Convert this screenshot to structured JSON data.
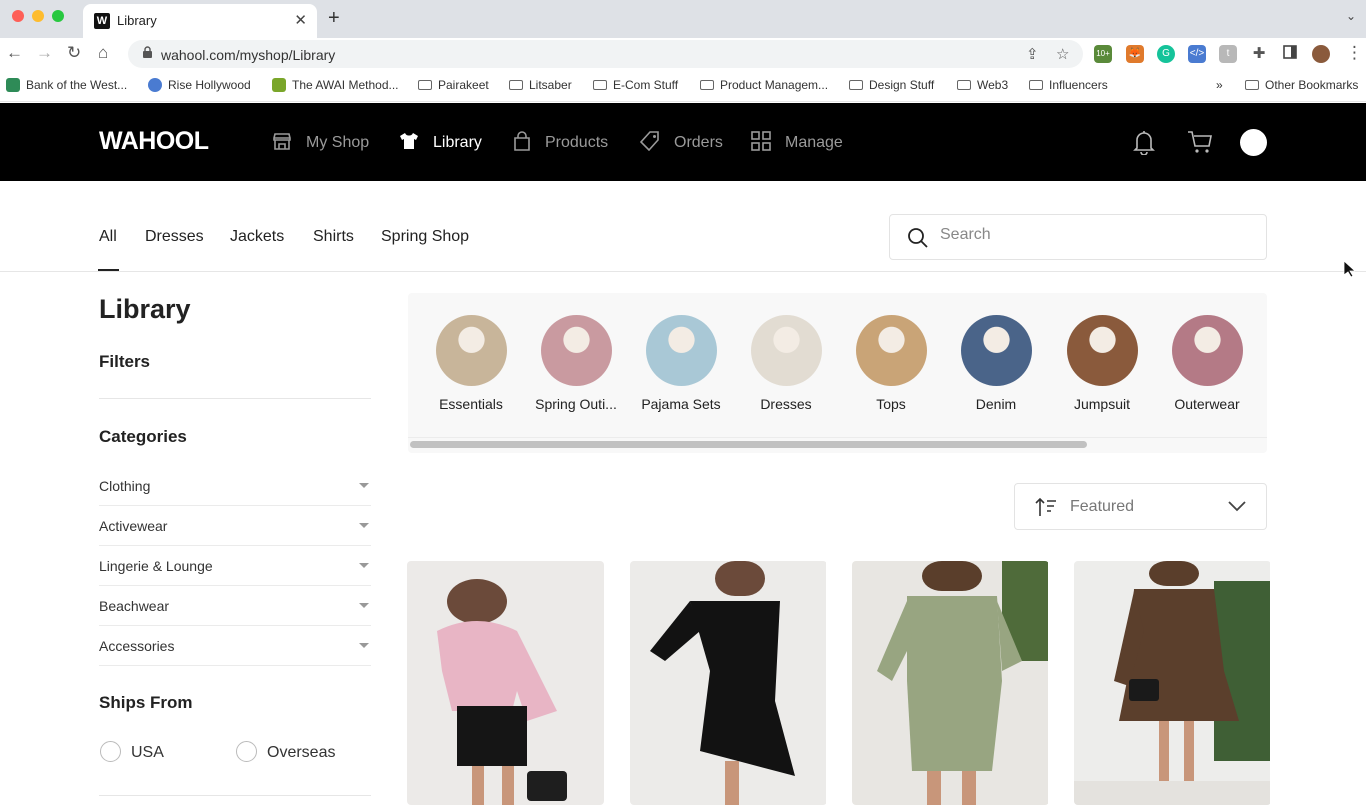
{
  "browser": {
    "tab_title": "Library",
    "tab_favicon_letter": "W",
    "url": "wahool.com/myshop/Library",
    "extension_badge": "10+",
    "bookmarks": [
      "Bank of the West...",
      "Rise Hollywood",
      "The AWAI Method...",
      "Pairakeet",
      "Litsaber",
      "E-Com Stuff",
      "Product Managem...",
      "Design Stuff",
      "Web3",
      "Influencers"
    ],
    "bookmarks_overflow": "»",
    "other_bookmarks": "Other Bookmarks"
  },
  "header": {
    "logo": "WAHOOL",
    "nav": [
      {
        "label": "My Shop",
        "icon": "store-icon",
        "active": false
      },
      {
        "label": "Library",
        "icon": "shirt-icon",
        "active": true
      },
      {
        "label": "Products",
        "icon": "bag-icon",
        "active": false
      },
      {
        "label": "Orders",
        "icon": "tag-icon",
        "active": false
      },
      {
        "label": "Manage",
        "icon": "grid-icon",
        "active": false
      }
    ]
  },
  "category_tabs": [
    "All",
    "Dresses",
    "Jackets",
    "Shirts",
    "Spring Shop"
  ],
  "active_tab": "All",
  "search": {
    "placeholder": "Search",
    "value": ""
  },
  "sidebar": {
    "title": "Library",
    "filters_heading": "Filters",
    "categories_heading": "Categories",
    "categories": [
      "Clothing",
      "Activewear",
      "Lingerie & Lounge",
      "Beachwear",
      "Accessories"
    ],
    "ships_from_heading": "Ships From",
    "ships_from_options": [
      "USA",
      "Overseas"
    ]
  },
  "collections": [
    {
      "label": "Essentials",
      "color": "#c8b59a"
    },
    {
      "label": "Spring Outi...",
      "color": "#c99aa0"
    },
    {
      "label": "Pajama Sets",
      "color": "#a9c8d6"
    },
    {
      "label": "Dresses",
      "color": "#e2dcd2"
    },
    {
      "label": "Tops",
      "color": "#c9a477"
    },
    {
      "label": "Denim",
      "color": "#4a6489"
    },
    {
      "label": "Jumpsuit",
      "color": "#8a5a3c"
    },
    {
      "label": "Outerwear",
      "color": "#b47a86"
    }
  ],
  "sort": {
    "label": "Featured"
  },
  "products": [
    {
      "name": "pink-blouse-black-skirt",
      "color_top": "#e6b8c6",
      "color_bottom": "#1a1a1a"
    },
    {
      "name": "black-one-shoulder-dress",
      "color_top": "#111111",
      "color_bottom": "#111111"
    },
    {
      "name": "sage-square-neck-dress",
      "color_top": "#9aa684",
      "color_bottom": "#8d9a78"
    },
    {
      "name": "brown-striped-wrap-dress",
      "color_top": "#5a3e2b",
      "color_bottom": "#5a3e2b"
    }
  ]
}
